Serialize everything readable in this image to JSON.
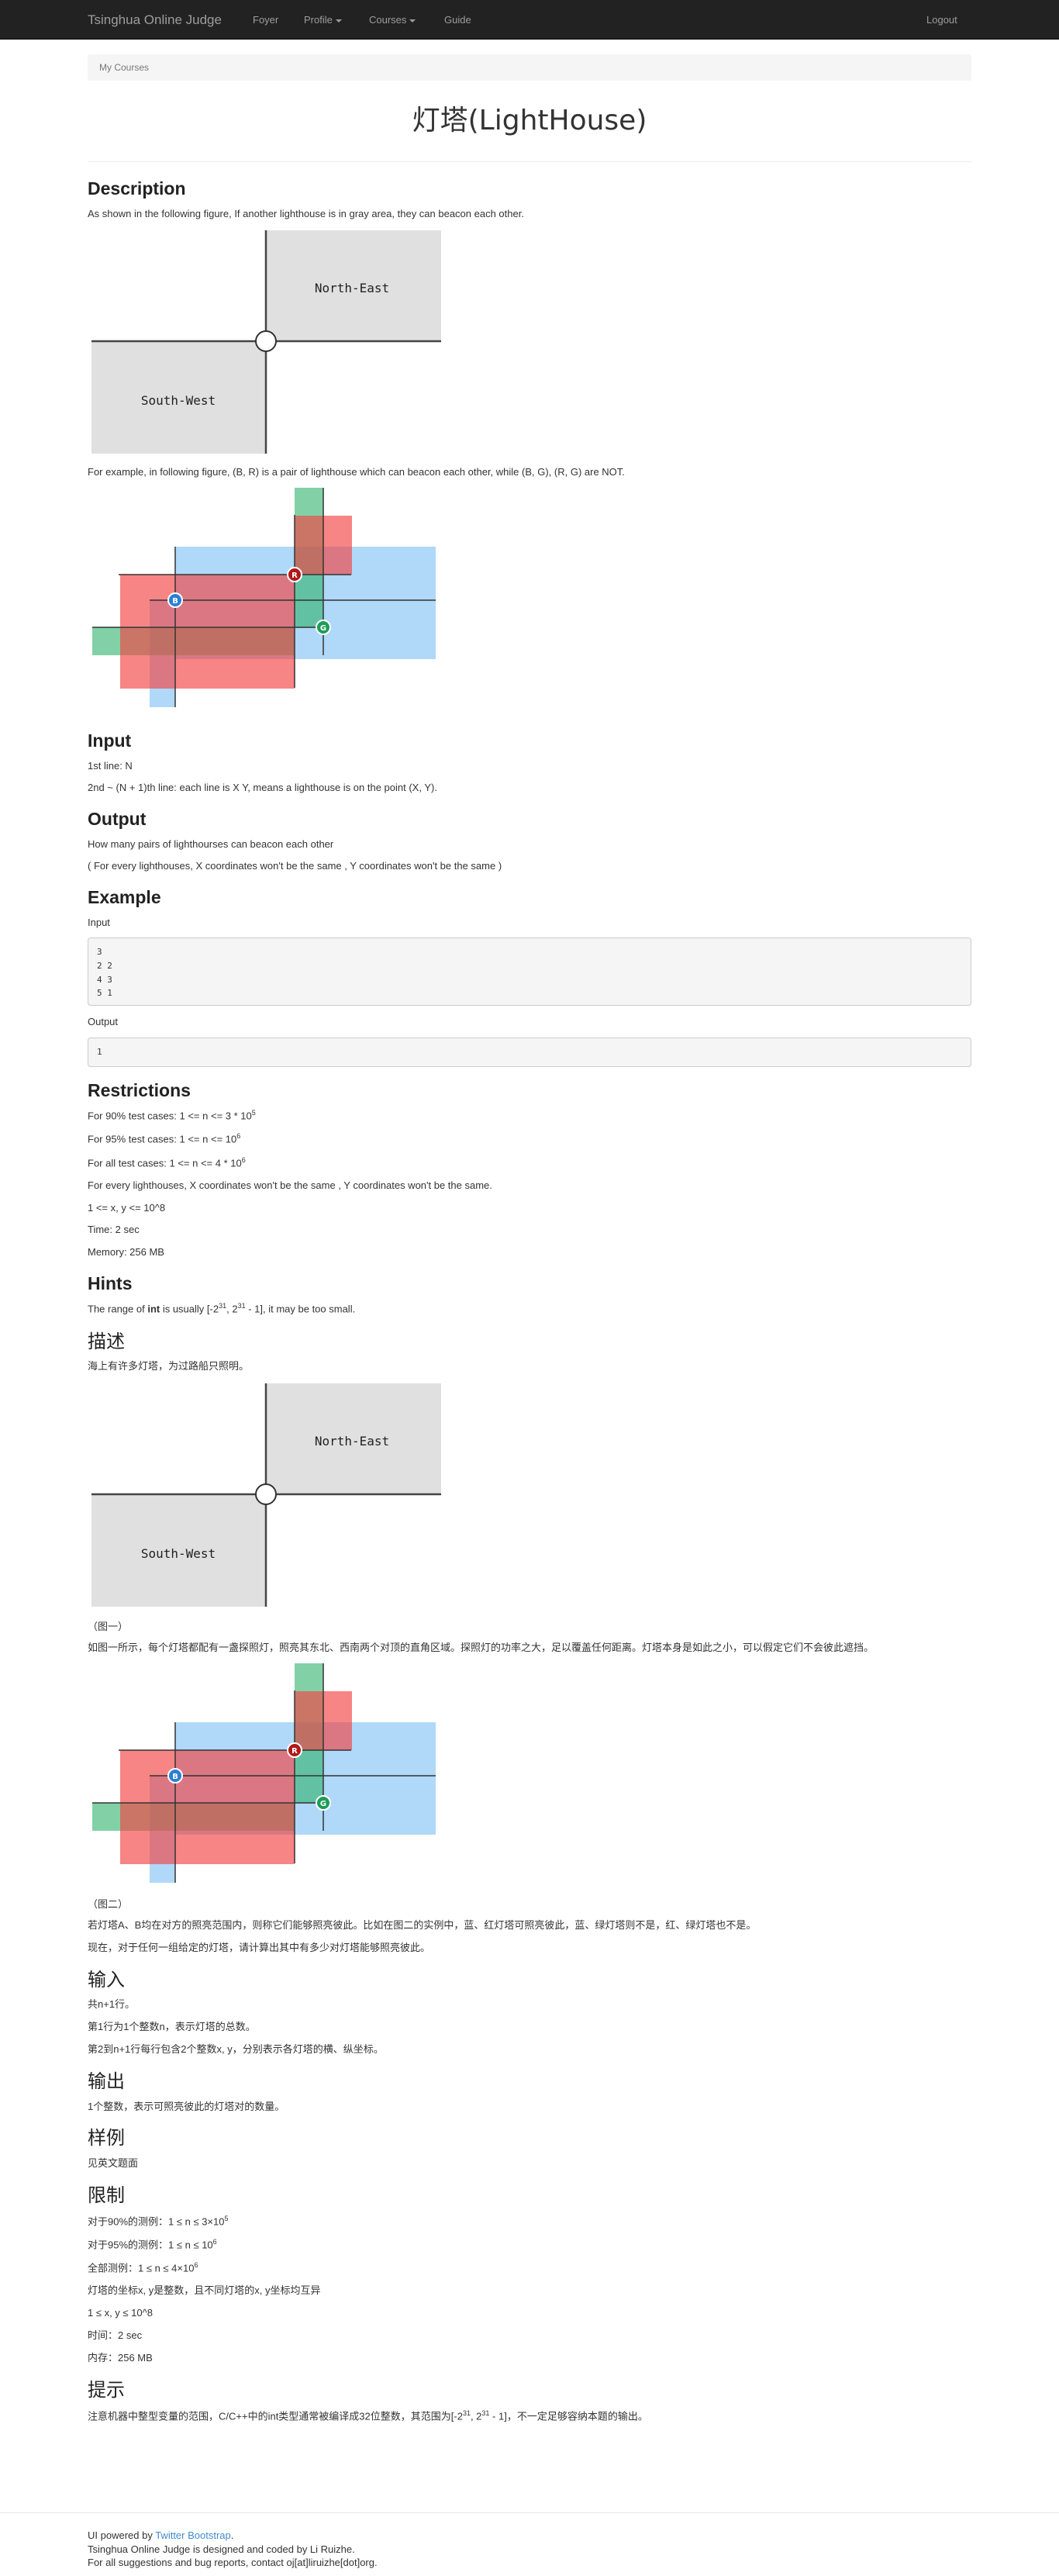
{
  "navbar": {
    "brand": "Tsinghua Online Judge",
    "foyer": "Foyer",
    "profile": "Profile",
    "courses": "Courses",
    "guide": "Guide",
    "logout": "Logout"
  },
  "breadcrumb": "My Courses",
  "title": "灯塔(LightHouse)",
  "figure1": {
    "ne": "North-East",
    "sw": "South-West"
  },
  "figure2": {
    "b": "B",
    "r": "R",
    "g": "G"
  },
  "en": {
    "description_h": "Description",
    "description_p1": "As shown in the following figure, If another lighthouse is in gray area, they can beacon each other.",
    "description_p2": "For example, in following figure, (B, R) is a pair of lighthouse which can beacon each other, while (B, G), (R, G) are NOT.",
    "input_h": "Input",
    "input_p1": "1st line: N",
    "input_p2": "2nd ~ (N + 1)th line: each line is X Y, means a lighthouse is on the point (X, Y).",
    "output_h": "Output",
    "output_p1": "How many pairs of lighthourses can beacon each other",
    "output_p2": "( For every lighthouses, X coordinates won't be the same , Y coordinates won't be the same )",
    "example_h": "Example",
    "example_input_label": "Input",
    "example_input": "3\n2 2\n4 3\n5 1",
    "example_output_label": "Output",
    "example_output": "1",
    "restrictions_h": "Restrictions",
    "r1a": "For 90% test cases: 1 <= n <= 3 * 10",
    "r1s": "5",
    "r2a": "For 95% test cases: 1 <= n <= 10",
    "r2s": "6",
    "r3a": "For all test cases: 1 <= n <= 4 * 10",
    "r3s": "6",
    "r4": "For every lighthouses, X coordinates won't be the same , Y coordinates won't be the same.",
    "r5": "1 <= x, y <= 10^8",
    "r6": "Time: 2 sec",
    "r7": "Memory: 256 MB",
    "hints_h": "Hints",
    "hint_a": "The range of ",
    "hint_b": "int",
    "hint_c": " is usually [-2",
    "hint_s1": "31",
    "hint_d": ", 2",
    "hint_s2": "31",
    "hint_e": " - 1], it may be too small."
  },
  "cn": {
    "desc_h": "描述",
    "desc_p1": "海上有许多灯塔，为过路船只照明。",
    "fig1_caption": "（图一）",
    "desc_p2": "如图一所示，每个灯塔都配有一盏探照灯，照亮其东北、西南两个对顶的直角区域。探照灯的功率之大，足以覆盖任何距离。灯塔本身是如此之小，可以假定它们不会彼此遮挡。",
    "fig2_caption": "（图二）",
    "desc_p3": "若灯塔A、B均在对方的照亮范围内，则称它们能够照亮彼此。比如在图二的实例中，蓝、红灯塔可照亮彼此，蓝、绿灯塔则不是，红、绿灯塔也不是。",
    "desc_p4": "现在，对于任何一组给定的灯塔，请计算出其中有多少对灯塔能够照亮彼此。",
    "input_h": "输入",
    "input_p1": "共n+1行。",
    "input_p2": "第1行为1个整数n，表示灯塔的总数。",
    "input_p3": "第2到n+1行每行包含2个整数x, y，分别表示各灯塔的横、纵坐标。",
    "output_h": "输出",
    "output_p1": "1个整数，表示可照亮彼此的灯塔对的数量。",
    "example_h": "样例",
    "example_p1": "见英文题面",
    "restrict_h": "限制",
    "r1a": "对于90%的测例：1 ≤ n ≤ 3×10",
    "r1s": "5",
    "r2a": "对于95%的测例：1 ≤ n ≤ 10",
    "r2s": "6",
    "r3a": "全部测例：1 ≤ n ≤ 4×10",
    "r3s": "6",
    "r4": "灯塔的坐标x, y是整数，且不同灯塔的x, y坐标均互异",
    "r5": "1 ≤ x, y ≤ 10^8",
    "r6": "时间：2 sec",
    "r7": "内存：256 MB",
    "hint_h": "提示",
    "hint_a": "注意机器中整型变量的范围，C/C++中的int类型通常被编译成32位整数，其范围为[-2",
    "hint_s1": "31",
    "hint_b": ", 2",
    "hint_s2": "31",
    "hint_c": " - 1]，不一定足够容纳本题的输出。"
  },
  "footer": {
    "ui_a": "UI powered by ",
    "ui_link": "Twitter Bootstrap",
    "ui_b": ".",
    "line2": "Tsinghua Online Judge is designed and coded by Li Ruizhe.",
    "line3": "For all suggestions and bug reports, contact oj[at]liruizhe[dot]org."
  }
}
